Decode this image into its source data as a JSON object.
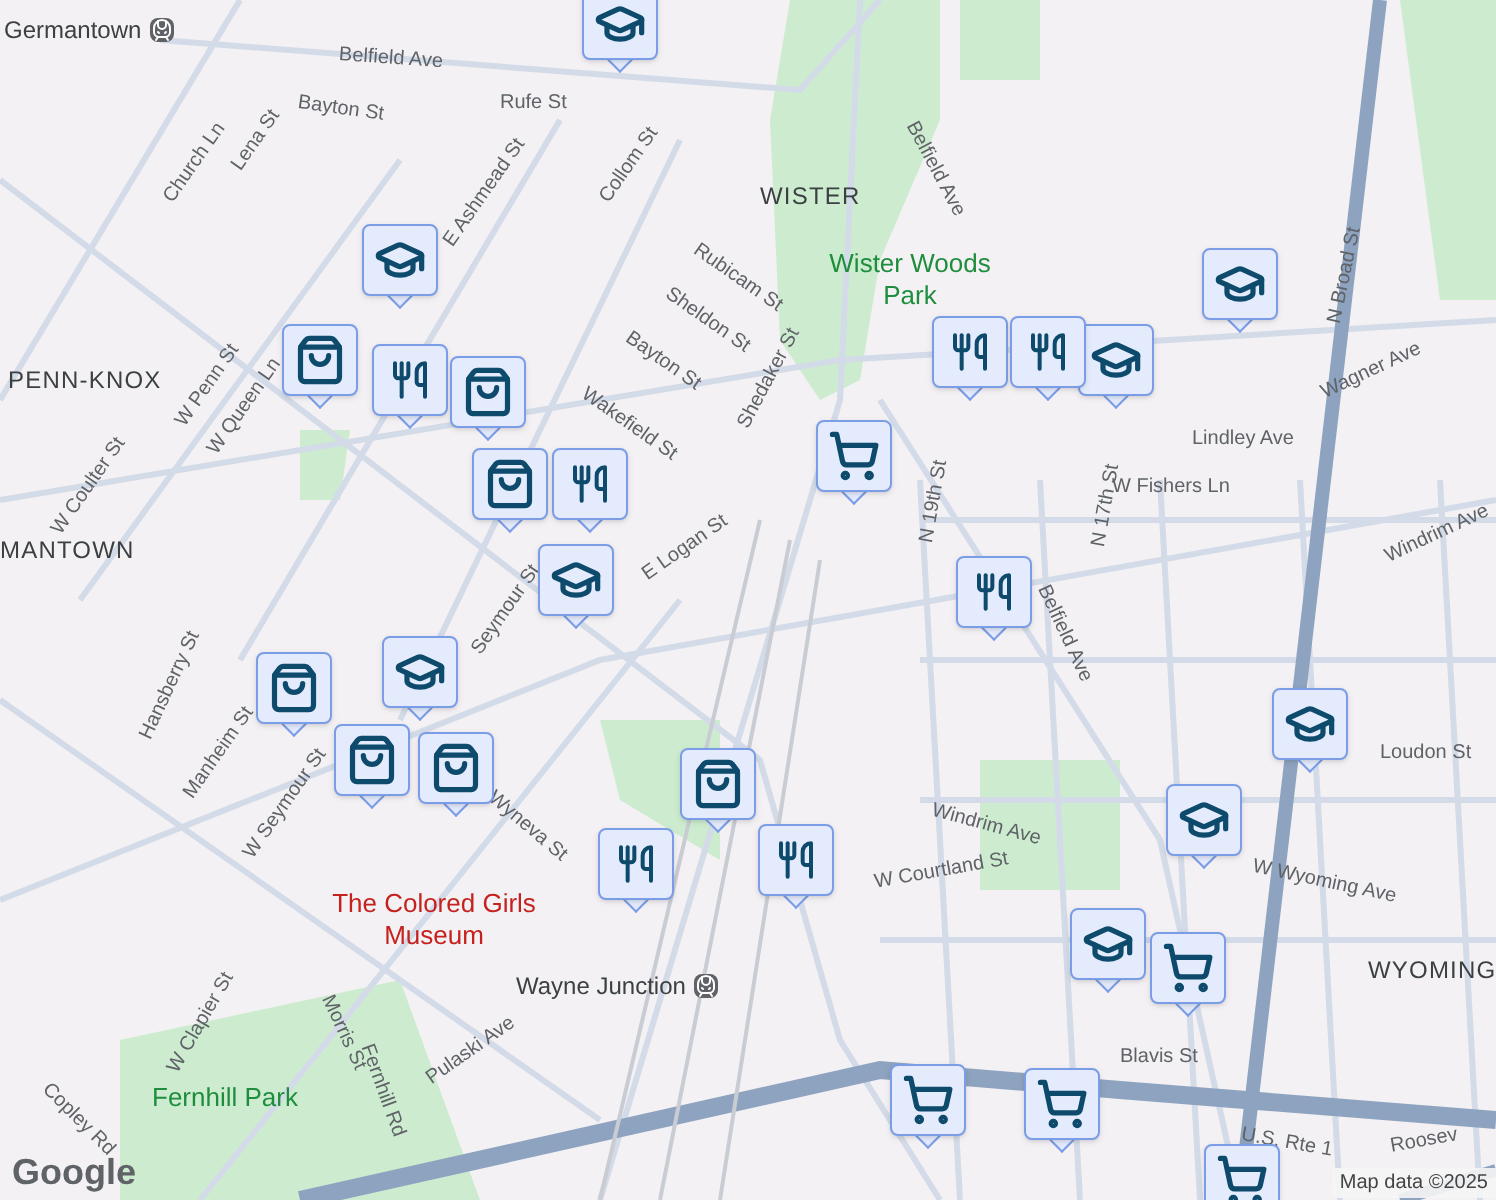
{
  "map_labels": [
    {
      "text": "Germantown",
      "kind": "station"
    },
    {
      "text": "Belfield Ave",
      "kind": "street"
    },
    {
      "text": "Bayton St",
      "kind": "street"
    },
    {
      "text": "Rufe St",
      "kind": "street"
    },
    {
      "text": "Belfield Ave",
      "kind": "street"
    },
    {
      "text": "WISTER",
      "kind": "area"
    },
    {
      "text": "Wister Woods Park",
      "kind": "park"
    },
    {
      "text": "Rubicam St",
      "kind": "street"
    },
    {
      "text": "Sheldon St",
      "kind": "street"
    },
    {
      "text": "Bayton St",
      "kind": "street"
    },
    {
      "text": "Shedaker St",
      "kind": "street"
    },
    {
      "text": "Collom St",
      "kind": "street"
    },
    {
      "text": "Wakefield St",
      "kind": "street"
    },
    {
      "text": "PENN-KNOX",
      "kind": "area"
    },
    {
      "text": "MANTOWN",
      "kind": "area"
    },
    {
      "text": "E Logan St",
      "kind": "street"
    },
    {
      "text": "Seymour St",
      "kind": "street"
    },
    {
      "text": "Lindley Ave",
      "kind": "street"
    },
    {
      "text": "W Fishers Ln",
      "kind": "street"
    },
    {
      "text": "Wagner Ave",
      "kind": "street"
    },
    {
      "text": "Windrim Ave",
      "kind": "street"
    },
    {
      "text": "Loudon St",
      "kind": "street"
    },
    {
      "text": "W Wyoming Ave",
      "kind": "street"
    },
    {
      "text": "WYOMING",
      "kind": "area"
    },
    {
      "text": "Windrim Ave",
      "kind": "street"
    },
    {
      "text": "W Courtland St",
      "kind": "street"
    },
    {
      "text": "The Colored Girls Museum",
      "kind": "place"
    },
    {
      "text": "Wayne Junction",
      "kind": "station"
    },
    {
      "text": "Fernhill Park",
      "kind": "park"
    },
    {
      "text": "Blavis St",
      "kind": "street"
    },
    {
      "text": "U.S. Rte 1",
      "kind": "street"
    },
    {
      "text": "Roosev",
      "kind": "street"
    },
    {
      "text": "Belfield Ave",
      "kind": "street"
    },
    {
      "text": "N Broad St",
      "kind": "street"
    },
    {
      "text": "Wyneva St",
      "kind": "street"
    },
    {
      "text": "Manheim St",
      "kind": "street"
    },
    {
      "text": "Hansberry St",
      "kind": "street"
    },
    {
      "text": "W Seymour St",
      "kind": "street"
    },
    {
      "text": "Pulaski Ave",
      "kind": "street"
    },
    {
      "text": "Fernhill Rd",
      "kind": "street"
    },
    {
      "text": "Morris St",
      "kind": "street"
    },
    {
      "text": "W Clapier St",
      "kind": "street"
    },
    {
      "text": "W Coulter St",
      "kind": "street"
    },
    {
      "text": "W Penn St",
      "kind": "street"
    },
    {
      "text": "W Queen Ln",
      "kind": "street"
    },
    {
      "text": "N 19th St",
      "kind": "street"
    },
    {
      "text": "N 17th St",
      "kind": "street"
    },
    {
      "text": "Lena St",
      "kind": "street"
    },
    {
      "text": "Church Ln",
      "kind": "street"
    },
    {
      "text": "Copley Rd",
      "kind": "street"
    },
    {
      "text": "E Ashmead St",
      "kind": "street"
    }
  ],
  "markers": [
    {
      "kind": "school"
    },
    {
      "kind": "school"
    },
    {
      "kind": "shopping"
    },
    {
      "kind": "dining"
    },
    {
      "kind": "shopping"
    },
    {
      "kind": "shopping"
    },
    {
      "kind": "school"
    },
    {
      "kind": "dining"
    },
    {
      "kind": "grocery"
    },
    {
      "kind": "dining"
    },
    {
      "kind": "school"
    },
    {
      "kind": "school"
    },
    {
      "kind": "dining"
    },
    {
      "kind": "school"
    },
    {
      "kind": "school"
    },
    {
      "kind": "shopping"
    },
    {
      "kind": "shopping"
    },
    {
      "kind": "shopping"
    },
    {
      "kind": "school"
    },
    {
      "kind": "shopping"
    },
    {
      "kind": "dining"
    },
    {
      "kind": "dining"
    },
    {
      "kind": "school"
    },
    {
      "kind": "dining"
    },
    {
      "kind": "grocery"
    },
    {
      "kind": "grocery"
    },
    {
      "kind": "grocery"
    },
    {
      "kind": "grocery"
    }
  ],
  "attribution": {
    "logo": "Google",
    "map_data": "Map data ©2025"
  }
}
